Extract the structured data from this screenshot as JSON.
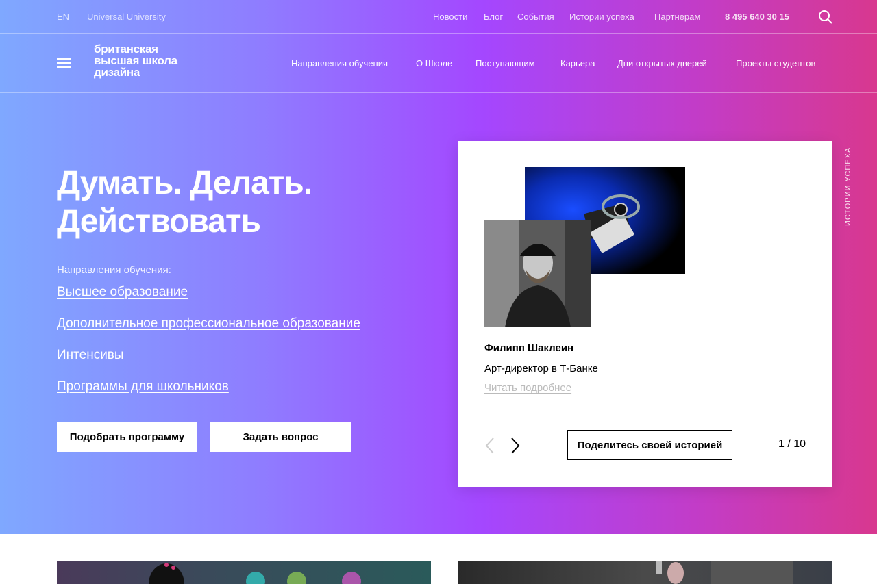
{
  "topbar": {
    "lang": "EN",
    "university": "Universal University",
    "links": [
      "Новости",
      "Блог",
      "События",
      "Истории успеха",
      "Партнерам"
    ],
    "phone": "8 495 640 30 15",
    "search_icon": "search-icon"
  },
  "navbar": {
    "menu_icon": "hamburger-menu-icon",
    "logo_lines": [
      "британская",
      "высшая школа",
      "дизайна"
    ],
    "links": [
      "Направления обучения",
      "О Школе",
      "Поступающим",
      "Карьера",
      "Дни открытых дверей",
      "Проекты студентов"
    ]
  },
  "hero": {
    "headline_lines": [
      "Думать. Делать.",
      "Действовать"
    ],
    "directions_label": "Направления обучения:",
    "directions": [
      "Высшее образование",
      "Дополнительное профессиональное образование",
      "Интенсивы",
      "Программы для школьников"
    ],
    "btn_pick": "Подобрать программу",
    "btn_ask": "Задать вопрос"
  },
  "story": {
    "name": "Филипп Шаклеин",
    "role": "Арт-директор в Т-Банке",
    "read_more": "Читать подробнее",
    "share": "Поделитесь своей историей",
    "counter": "1 / 10",
    "prev_icon": "chevron-left-icon",
    "next_icon": "chevron-right-icon",
    "side_label": "ИСТОРИИ УСПЕХА"
  },
  "colors": {
    "gradient_start": "#7fa8ff",
    "gradient_mid": "#a447ff",
    "gradient_end": "#d8388f"
  }
}
